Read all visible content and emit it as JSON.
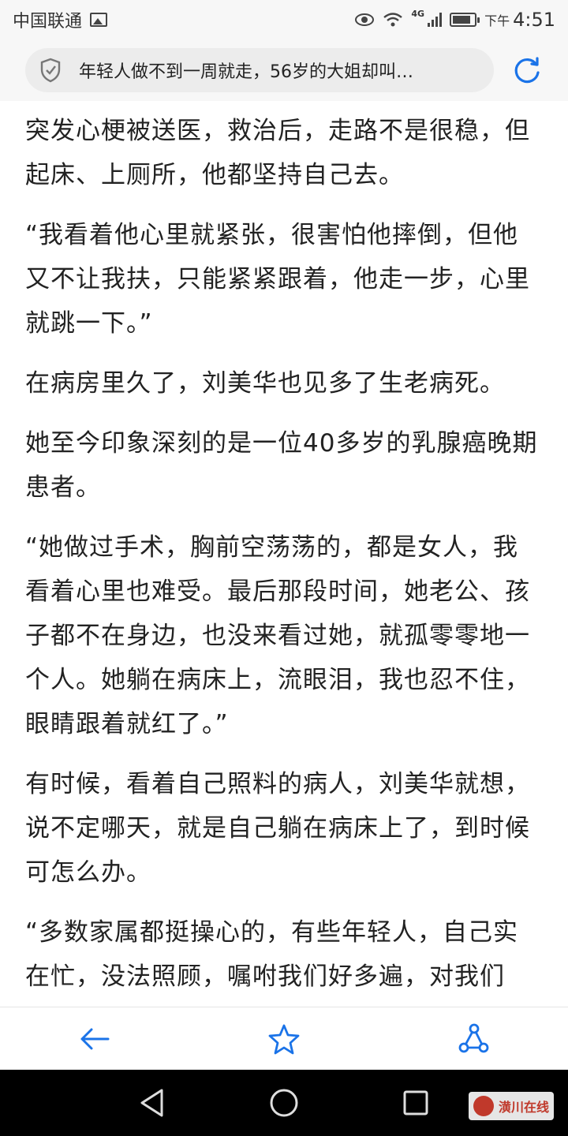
{
  "status_bar": {
    "carrier": "中国联通",
    "network": "4G",
    "ampm": "下午",
    "time": "4:51",
    "battery_level": 0.85
  },
  "address_bar": {
    "title": "年轻人做不到一周就走，56岁的大姐却叫…",
    "security_icon": "shield-check-icon",
    "refresh_icon": "refresh-icon"
  },
  "article": {
    "paragraphs": [
      "突发心梗被送医，救治后，走路不是很稳，但起床、上厕所，他都坚持自己去。",
      "“我看着他心里就紧张，很害怕他摔倒，但他又不让我扶，只能紧紧跟着，他走一步，心里就跳一下。”",
      "在病房里久了，刘美华也见多了生老病死。",
      "她至今印象深刻的是一位40多岁的乳腺癌晚期患者。",
      "“她做过手术，胸前空荡荡的，都是女人，我看着心里也难受。最后那段时间，她老公、孩子都不在身边，也没来看过她，就孤零零地一个人。她躺在病床上，流眼泪，我也忍不住，眼睛跟着就红了。”",
      "有时候，看着自己照料的病人，刘美华就想，说不定哪天，就是自己躺在病床上了，到时候可怎么办。",
      "“多数家属都挺操心的，有些年轻人，自己实在忙，没法照顾，嘱咐我们好多遍，对我们"
    ]
  },
  "toolbar": {
    "back_icon": "back-arrow-icon",
    "favorite_icon": "star-icon",
    "share_icon": "share-icon",
    "accent_color": "#1a73e8"
  },
  "nav_bar": {
    "back_icon": "triangle-back-icon",
    "home_icon": "circle-home-icon",
    "recents_icon": "square-recents-icon"
  },
  "watermark": {
    "text": "潢川在线"
  }
}
